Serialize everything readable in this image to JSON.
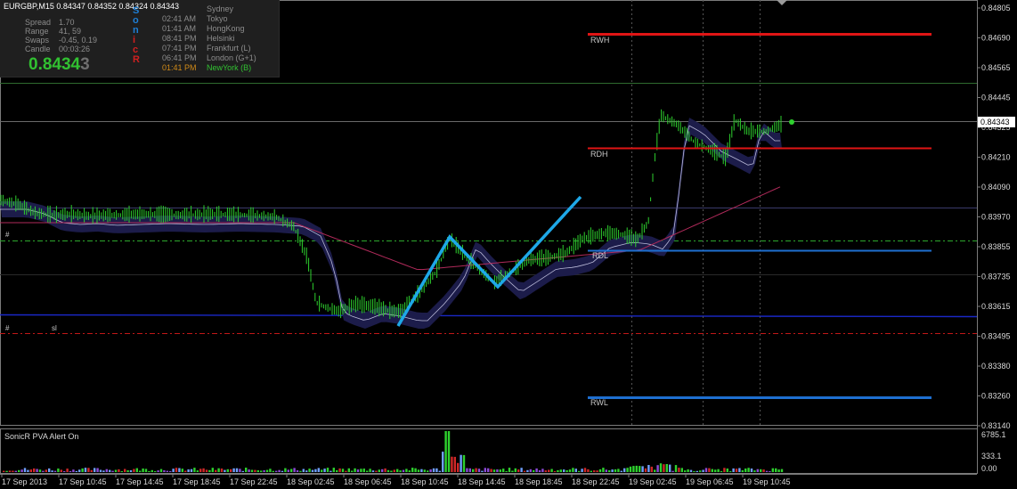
{
  "window": {
    "symbol_header": "EURGBP,M15  0.84347 0.84352 0.84324 0.84343"
  },
  "info_panel": {
    "stats": [
      {
        "label": "Spread",
        "value": "1.70"
      },
      {
        "label": "Range",
        "value": "41, 59"
      },
      {
        "label": "Swaps",
        "value": "-0.45, 0.19"
      },
      {
        "label": "Candle",
        "value": "00:03:26"
      }
    ],
    "price_main": "0.8434",
    "price_last_digit": "3",
    "sonic_letters": [
      {
        "char": "S",
        "color": "#1e7fd6"
      },
      {
        "char": "o",
        "color": "#1e7fd6"
      },
      {
        "char": "n",
        "color": "#1e7fd6"
      },
      {
        "char": "i",
        "color": "#d02020"
      },
      {
        "char": "c",
        "color": "#d02020"
      },
      {
        "char": "R",
        "color": "#d02020"
      }
    ],
    "sessions": [
      {
        "time": "",
        "name": "Sydney",
        "color": "#8c8c8c"
      },
      {
        "time": "02:41 AM",
        "name": "Tokyo",
        "color": "#8c8c8c"
      },
      {
        "time": "01:41 AM",
        "name": "HongKong",
        "color": "#8c8c8c"
      },
      {
        "time": "08:41 PM",
        "name": "Helsinki",
        "color": "#8c8c8c"
      },
      {
        "time": "07:41 PM",
        "name": "Frankfurt  (L)",
        "color": "#8c8c8c"
      },
      {
        "time": "06:41 PM",
        "name": "London  (G+1)",
        "color": "#8c8c8c"
      },
      {
        "time": "01:41 PM",
        "name": "NewYork  (B)",
        "color": "#d08a18",
        "name_color": "#31c131"
      }
    ]
  },
  "price_axis": {
    "labels": [
      "0.84805",
      "0.84690",
      "0.84565",
      "0.84445",
      "0.84325",
      "0.84210",
      "0.84090",
      "0.83970",
      "0.83855",
      "0.83735",
      "0.83615",
      "0.83495",
      "0.83380",
      "0.83260",
      "0.83140"
    ],
    "current_price": "0.84343"
  },
  "levels": {
    "rwh": "RWH",
    "rdh": "RDH",
    "rdl": "RDL",
    "rwl": "RWL"
  },
  "left_tags": {
    "tag_upper": "#",
    "tag_lower": "#",
    "tag_lower_mark": "sl"
  },
  "time_axis": {
    "labels": [
      "17 Sep 2013",
      "17 Sep 10:45",
      "17 Sep 14:45",
      "17 Sep 18:45",
      "17 Sep 22:45",
      "18 Sep 02:45",
      "18 Sep 06:45",
      "18 Sep 10:45",
      "18 Sep 14:45",
      "18 Sep 18:45",
      "18 Sep 22:45",
      "19 Sep 02:45",
      "19 Sep 06:45",
      "19 Sep 10:45"
    ]
  },
  "volume_panel": {
    "label": "SonicR PVA   Alert On",
    "axis_top": "6785.1",
    "axis_bottom": "0.00",
    "axis_mid": "333.1"
  },
  "colors": {
    "bull": "#2ed12e",
    "dragon": "#20204a",
    "resistance": "#e01515",
    "support": "#1e6fd0",
    "zigzag": "#1ea8e8"
  }
}
